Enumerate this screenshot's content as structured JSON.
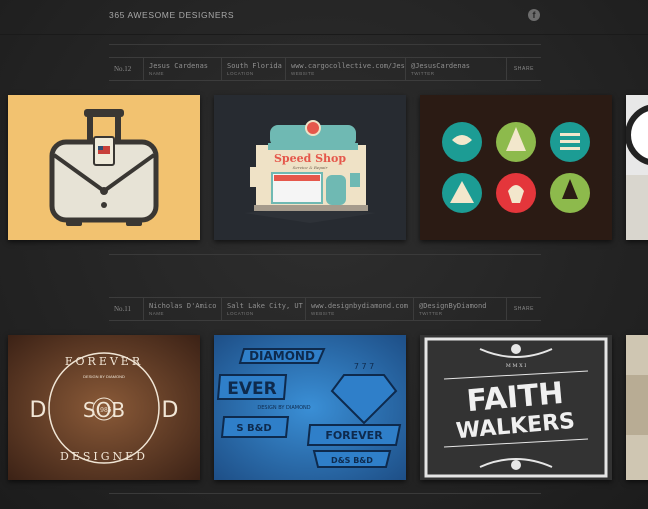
{
  "site": {
    "title": "365 AWESOME DESIGNERS",
    "fb_icon": "f"
  },
  "labels": {
    "name": "NAME",
    "location": "LOCATION",
    "website": "WEBSITE",
    "twitter": "TWITTER",
    "share": "SHARE"
  },
  "designers": [
    {
      "number": "No.12",
      "name": "Jesus Cardenas",
      "location": "South Florida",
      "website": "www.cargocollective.com/Jesus",
      "twitter": "@JesusCardenas",
      "works": [
        "suitcase-illustration",
        "speed-shop-illustration",
        "icon-badges"
      ],
      "speed_shop": {
        "sign": "Speed Shop",
        "sub": "Service & Repair"
      }
    },
    {
      "number": "No.11",
      "name": "Nicholas D'Amico",
      "location": "Salt Lake City, UT",
      "website": "www.designbydiamond.com",
      "twitter": "@DesignByDiamond",
      "works": [
        "forever-designed-badge",
        "diamond-poster",
        "faith-walkers-poster"
      ],
      "forever": {
        "top": "FOREVER",
        "bottom": "DESIGNED",
        "left": "D",
        "mid": "SOB",
        "right": "D",
        "year": "1985",
        "sub": "DESIGN BY DIAMOND"
      },
      "diamond": {
        "banner1": "DIAMOND",
        "banner2": "EVER",
        "banner3": "DESIGN BY DIAMOND",
        "banner4": "FOREVER",
        "banner5": "D&S B&D",
        "num": "7 7 7",
        "sb": "S B&D"
      },
      "faith": {
        "line1": "FAITH",
        "line2": "WALKERS",
        "roman": "M M X I"
      }
    }
  ]
}
